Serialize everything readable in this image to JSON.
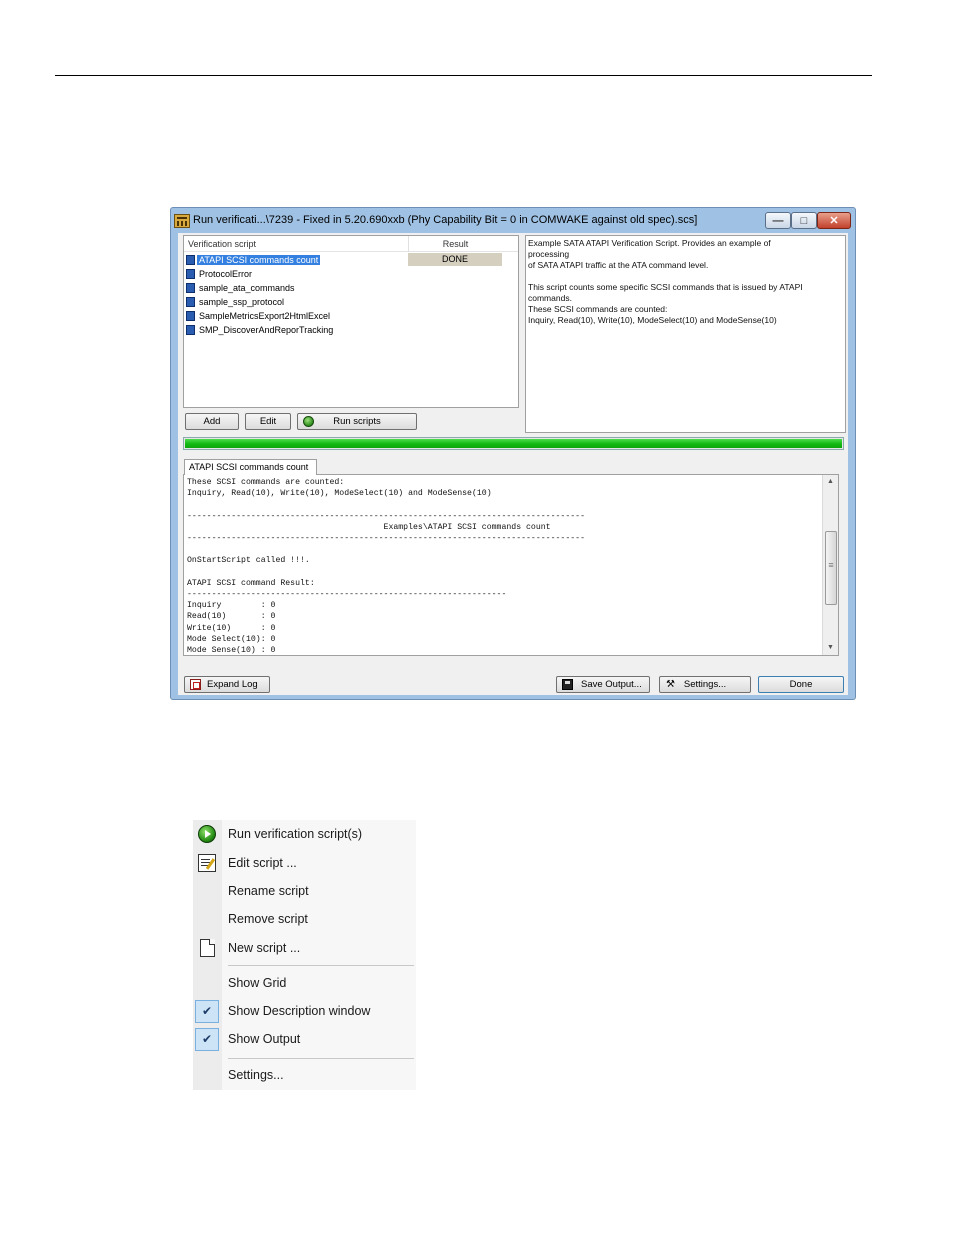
{
  "window": {
    "title": "Run verificati...\\7239 - Fixed in 5.20.690xxb (Phy Capability Bit = 0 in COMWAKE against old spec).scs]",
    "min_glyph": "—",
    "max_glyph": "□",
    "close_glyph": "✕"
  },
  "scripts": {
    "col_script": "Verification script",
    "col_result": "Result",
    "items": [
      {
        "name": "ATAPI SCSI commands count"
      },
      {
        "name": "ProtocolError"
      },
      {
        "name": "sample_ata_commands"
      },
      {
        "name": "sample_ssp_protocol"
      },
      {
        "name": "SampleMetricsExport2HtmlExcel"
      },
      {
        "name": "SMP_DiscoverAndReporTracking"
      }
    ],
    "first_result": "DONE"
  },
  "description": {
    "line1": "Example SATA ATAPI Verification Script. Provides an example of",
    "line2": "processing",
    "line3": "of SATA ATAPI traffic at the ATA command level.",
    "line4": "This script counts some specific SCSI commands that is issued by ATAPI",
    "line5": "commands.",
    "line6": "These SCSI commands are counted:",
    "line7": "Inquiry, Read(10), Write(10), ModeSelect(10) and ModeSense(10)"
  },
  "buttons": {
    "add": "Add",
    "edit": "Edit",
    "run_scripts": "Run scripts",
    "expand_log": "Expand Log",
    "save_output": "Save Output...",
    "settings": "Settings...",
    "done": "Done"
  },
  "progress": {
    "fraction": 1.0
  },
  "output": {
    "tab_label": "ATAPI SCSI commands count",
    "text": "These SCSI commands are counted:\nInquiry, Read(10), Write(10), ModeSelect(10) and ModeSense(10)\n\n---------------------------------------------------------------------------------\n                                        Examples\\ATAPI SCSI commands count\n---------------------------------------------------------------------------------\n\nOnStartScript called !!!.\n\nATAPI SCSI command Result:\n-----------------------------------------------------------------\nInquiry        : 0\nRead(10)       : 0\nWrite(10)      : 0\nMode Select(10): 0\nMode Sense(10) : 0",
    "scroll_up": "▲",
    "scroll_down": "▼"
  },
  "context_menu": {
    "run": "Run verification script(s)",
    "edit": "Edit script ...",
    "rename": "Rename script",
    "remove": "Remove script",
    "new": "New script ...",
    "show_grid": "Show Grid",
    "show_description": "Show Description window",
    "show_output": "Show Output",
    "settings": "Settings...",
    "check_glyph": "✔"
  }
}
